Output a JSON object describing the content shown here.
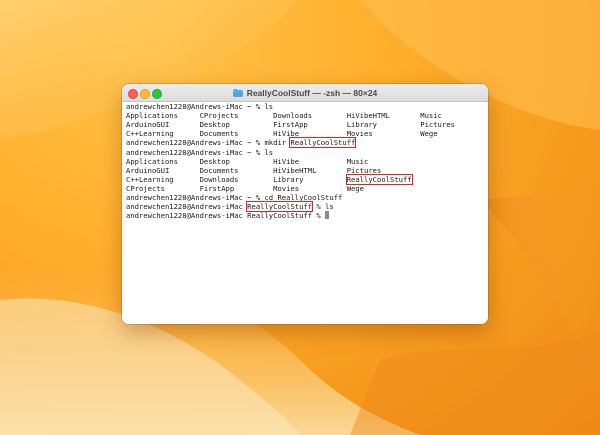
{
  "window": {
    "title": "ReallyCoolStuff — -zsh — 80×24",
    "folder_icon": "folder-icon"
  },
  "colors": {
    "highlight": "#e0241b",
    "close": "#fe5f57",
    "minimize": "#febc2e",
    "maximize": "#28c840"
  },
  "terminal": {
    "lines": [
      {
        "parts": [
          {
            "text": "andrewchen1228@Andrews-iMac ~ % ls"
          }
        ]
      },
      {
        "parts": [
          {
            "text": "Applications     CProjects        Downloads        HiVibeHTML       Music"
          }
        ]
      },
      {
        "parts": [
          {
            "text": "ArduinoGUI       Desktop          FirstApp         Library          Pictures"
          }
        ]
      },
      {
        "parts": [
          {
            "text": "C++Learning      Documents        HiVibe           Movies           Wege"
          }
        ]
      },
      {
        "parts": [
          {
            "text": "andrewchen1228@Andrews-iMac ~ % mkdir "
          },
          {
            "text": "ReallyCoolStuff",
            "hl": true
          }
        ]
      },
      {
        "parts": [
          {
            "text": "andrewchen1228@Andrews-iMac ~ % ls"
          }
        ]
      },
      {
        "parts": [
          {
            "text": "Applications     Desktop          HiVibe           Music"
          }
        ]
      },
      {
        "parts": [
          {
            "text": "ArduinoGUI       Documents        HiVibeHTML       Pictures"
          }
        ]
      },
      {
        "parts": [
          {
            "text": "C++Learning      Downloads        Library          "
          },
          {
            "text": "ReallyCoolStuff",
            "hl": true
          }
        ]
      },
      {
        "parts": [
          {
            "text": "CProjects        FirstApp         Movies           Wege"
          }
        ]
      },
      {
        "parts": [
          {
            "text": "andrewchen1228@Andrews-iMac ~ % cd ReallyCoolStuff"
          }
        ]
      },
      {
        "parts": [
          {
            "text": "andrewchen1228@Andrews-iMac "
          },
          {
            "text": "ReallyCoolStuff",
            "hl": true
          },
          {
            "text": " % ls"
          }
        ]
      },
      {
        "parts": [
          {
            "text": "andrewchen1228@Andrews-iMac ReallyCoolStuff % "
          }
        ],
        "cursor": true
      }
    ]
  }
}
